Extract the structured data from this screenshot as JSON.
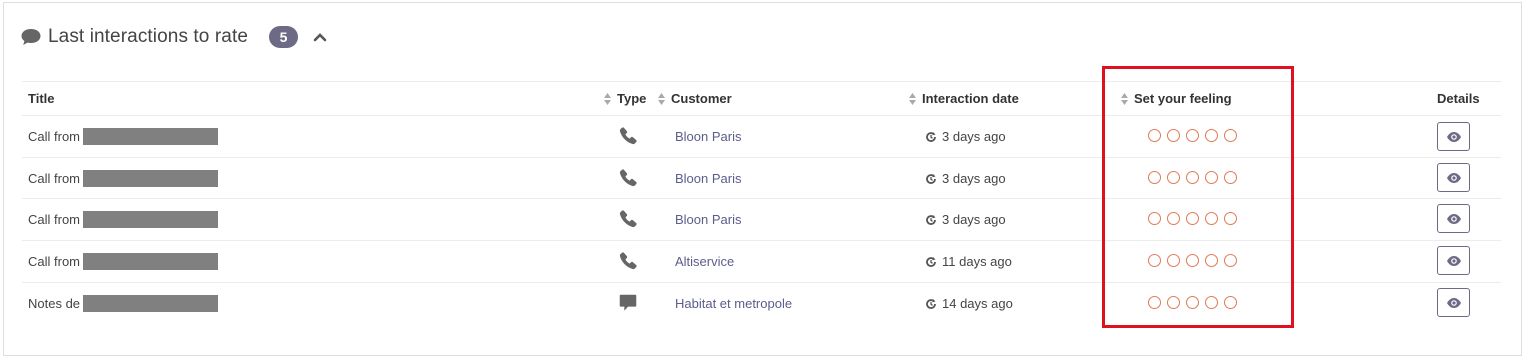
{
  "panel": {
    "title": "Last interactions to rate",
    "badge_count": "5",
    "icon": "comment-icon",
    "toggle_icon": "chevron-up-icon"
  },
  "table": {
    "columns": {
      "title": "Title",
      "type": "Type",
      "customer": "Customer",
      "interaction_date": "Interaction date",
      "feeling": "Set your feeling",
      "details": "Details"
    },
    "rows": [
      {
        "title": "Call from",
        "type_icon": "phone-icon",
        "customer": "Bloon Paris",
        "date": "3 days ago",
        "rating": 0
      },
      {
        "title": "Call from",
        "type_icon": "phone-icon",
        "customer": "Bloon Paris",
        "date": "3 days ago",
        "rating": 0
      },
      {
        "title": "Call from",
        "type_icon": "phone-icon",
        "customer": "Bloon Paris",
        "date": "3 days ago",
        "rating": 0
      },
      {
        "title": "Call from",
        "type_icon": "phone-icon",
        "customer": "Altiservice",
        "date": "11 days ago",
        "rating": 0
      },
      {
        "title": "Notes de",
        "type_icon": "note-icon",
        "customer": "Habitat et metropole",
        "date": "14 days ago",
        "rating": 0
      }
    ]
  },
  "colors": {
    "accent": "#6c6a85",
    "link": "#5b5d8b",
    "rating_circle": "#e07a55",
    "highlight": "#e0111e",
    "redaction": "#808080"
  }
}
